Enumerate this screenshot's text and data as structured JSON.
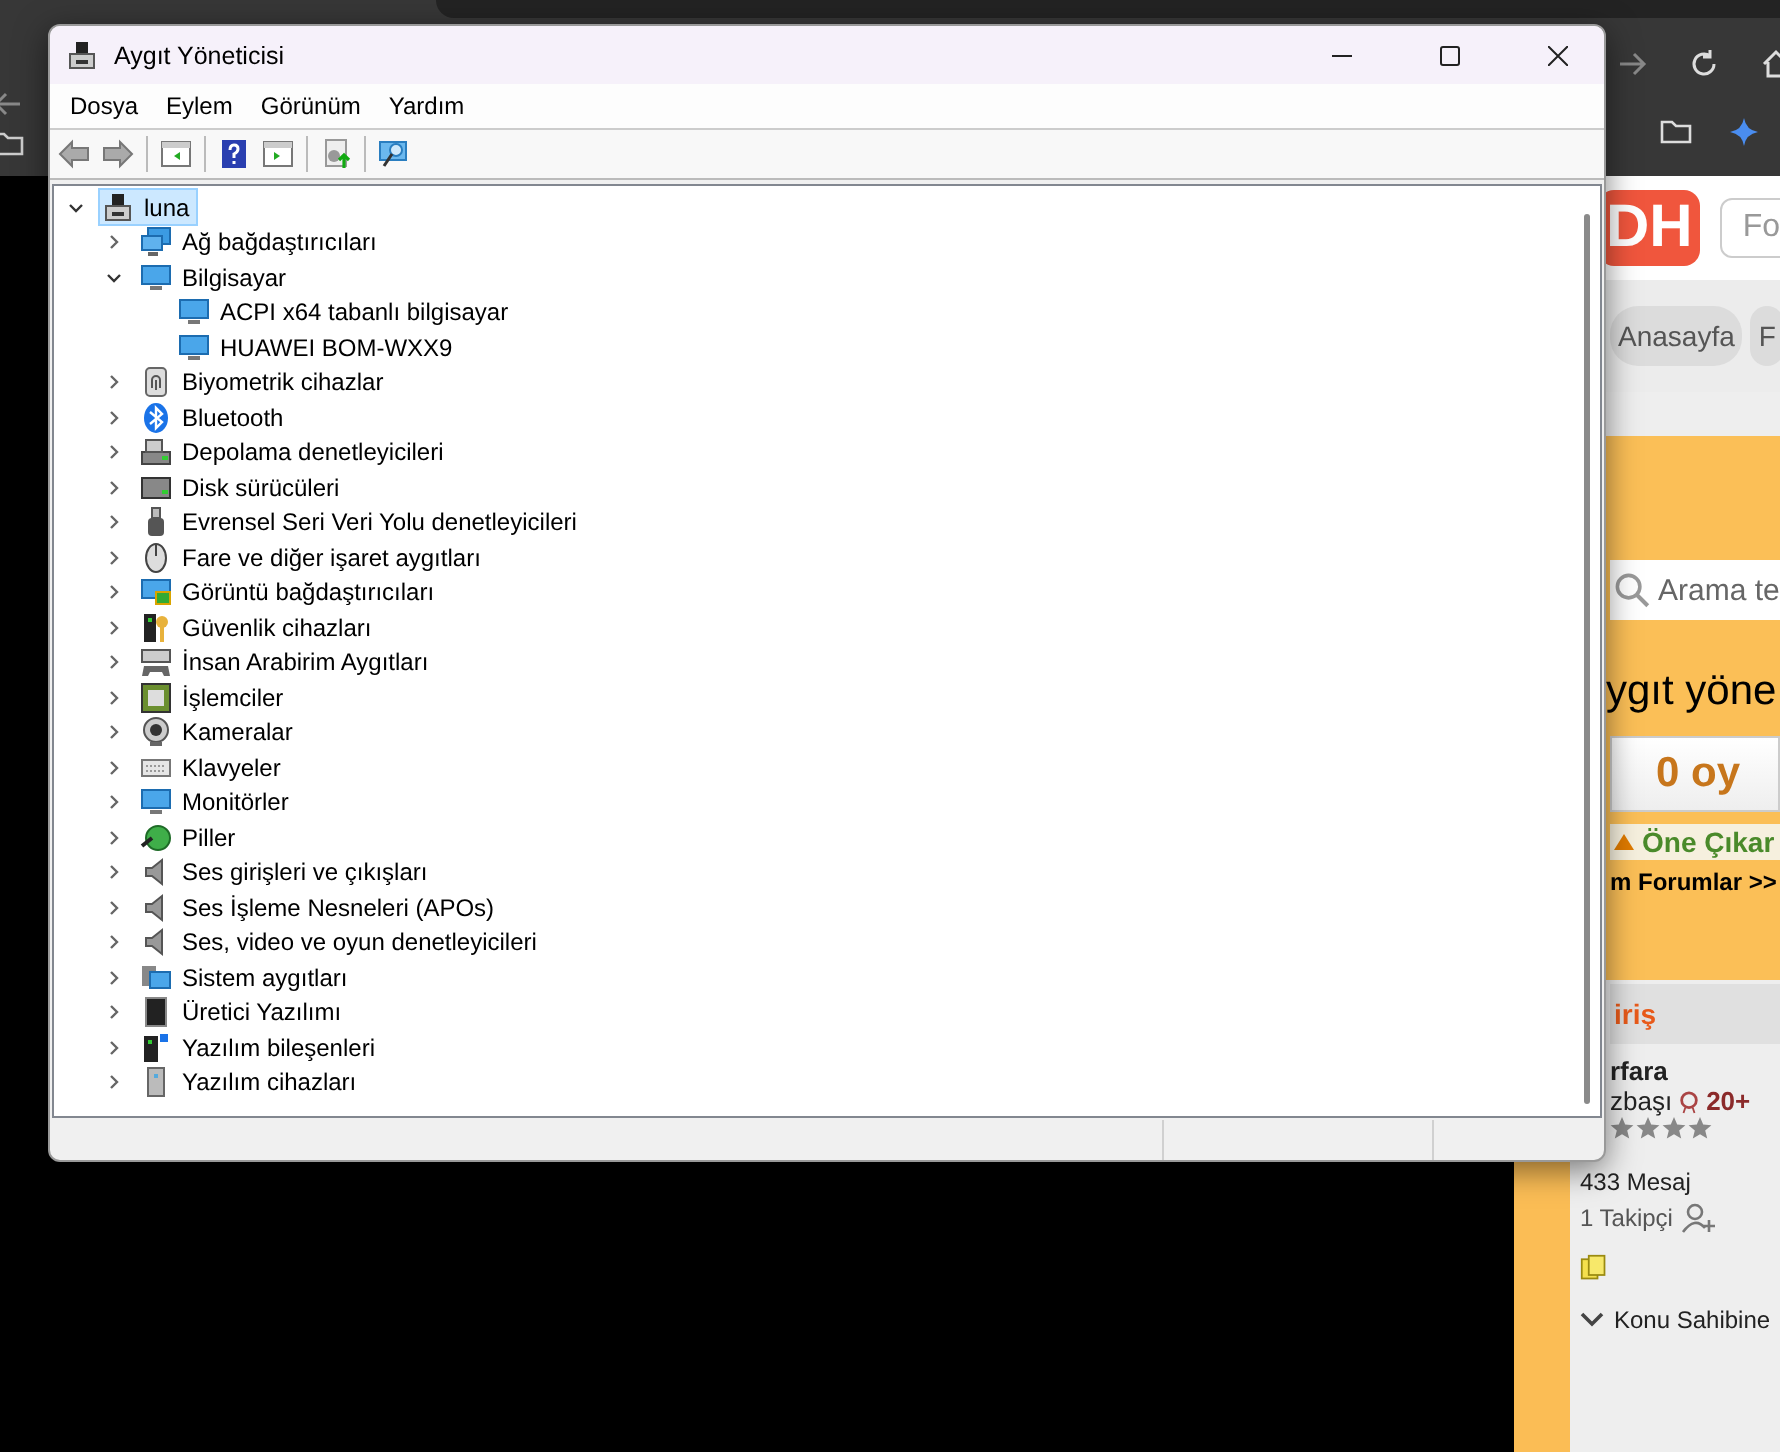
{
  "browser": {
    "page": {
      "logo": "DH",
      "top_search": {
        "placeholder": "Fo"
      },
      "nav": [
        {
          "label": "Anasayfa"
        },
        {
          "label": "F"
        }
      ],
      "search": {
        "placeholder": "Arama te"
      },
      "title": "ygıt yöne",
      "vote": "0 oy",
      "feature": "Öne Çıkar",
      "forums": "m Forumlar >>",
      "login": "iriş",
      "user": {
        "name": "rfara",
        "rank": "zbaşı",
        "points": "20+",
        "stars": 4,
        "messages": "433 Mesaj",
        "followers": "1 Takipçi"
      },
      "author_link": "Konu Sahibine"
    }
  },
  "window": {
    "title": "Aygıt Yöneticisi"
  },
  "menu": [
    "Dosya",
    "Eylem",
    "Görünüm",
    "Yardım"
  ],
  "tree": {
    "label": "luna",
    "expanded": true,
    "selected": true,
    "children": [
      {
        "label": "Ağ bağdaştırıcıları",
        "expanded": false,
        "selected": false
      },
      {
        "label": "Bilgisayar",
        "expanded": true,
        "selected": false,
        "children": [
          {
            "label": "ACPI x64 tabanlı bilgisayar",
            "selected": false
          },
          {
            "label": "HUAWEI BOM-WXX9",
            "selected": false
          }
        ]
      },
      {
        "label": "Biyometrik cihazlar",
        "expanded": false,
        "selected": false
      },
      {
        "label": "Bluetooth",
        "expanded": false,
        "selected": false
      },
      {
        "label": "Depolama denetleyicileri",
        "expanded": false,
        "selected": false
      },
      {
        "label": "Disk sürücüleri",
        "expanded": false,
        "selected": false
      },
      {
        "label": "Evrensel Seri Veri Yolu denetleyicileri",
        "expanded": false,
        "selected": false
      },
      {
        "label": "Fare ve diğer işaret aygıtları",
        "expanded": false,
        "selected": false
      },
      {
        "label": "Görüntü bağdaştırıcıları",
        "expanded": false,
        "selected": false
      },
      {
        "label": "Güvenlik cihazları",
        "expanded": false,
        "selected": false
      },
      {
        "label": "İnsan Arabirim Aygıtları",
        "expanded": false,
        "selected": false
      },
      {
        "label": "İşlemciler",
        "expanded": false,
        "selected": false
      },
      {
        "label": "Kameralar",
        "expanded": false,
        "selected": false
      },
      {
        "label": "Klavyeler",
        "expanded": false,
        "selected": false
      },
      {
        "label": "Monitörler",
        "expanded": false,
        "selected": false
      },
      {
        "label": "Piller",
        "expanded": false,
        "selected": false
      },
      {
        "label": "Ses girişleri ve çıkışları",
        "expanded": false,
        "selected": false
      },
      {
        "label": "Ses İşleme Nesneleri (APOs)",
        "expanded": false,
        "selected": false
      },
      {
        "label": "Ses, video ve oyun denetleyicileri",
        "expanded": false,
        "selected": false
      },
      {
        "label": "Sistem aygıtları",
        "expanded": false,
        "selected": false
      },
      {
        "label": "Üretici Yazılımı",
        "expanded": false,
        "selected": false
      },
      {
        "label": "Yazılım bileşenleri",
        "expanded": false,
        "selected": false
      },
      {
        "label": "Yazılım cihazları",
        "expanded": false,
        "selected": false
      }
    ]
  }
}
